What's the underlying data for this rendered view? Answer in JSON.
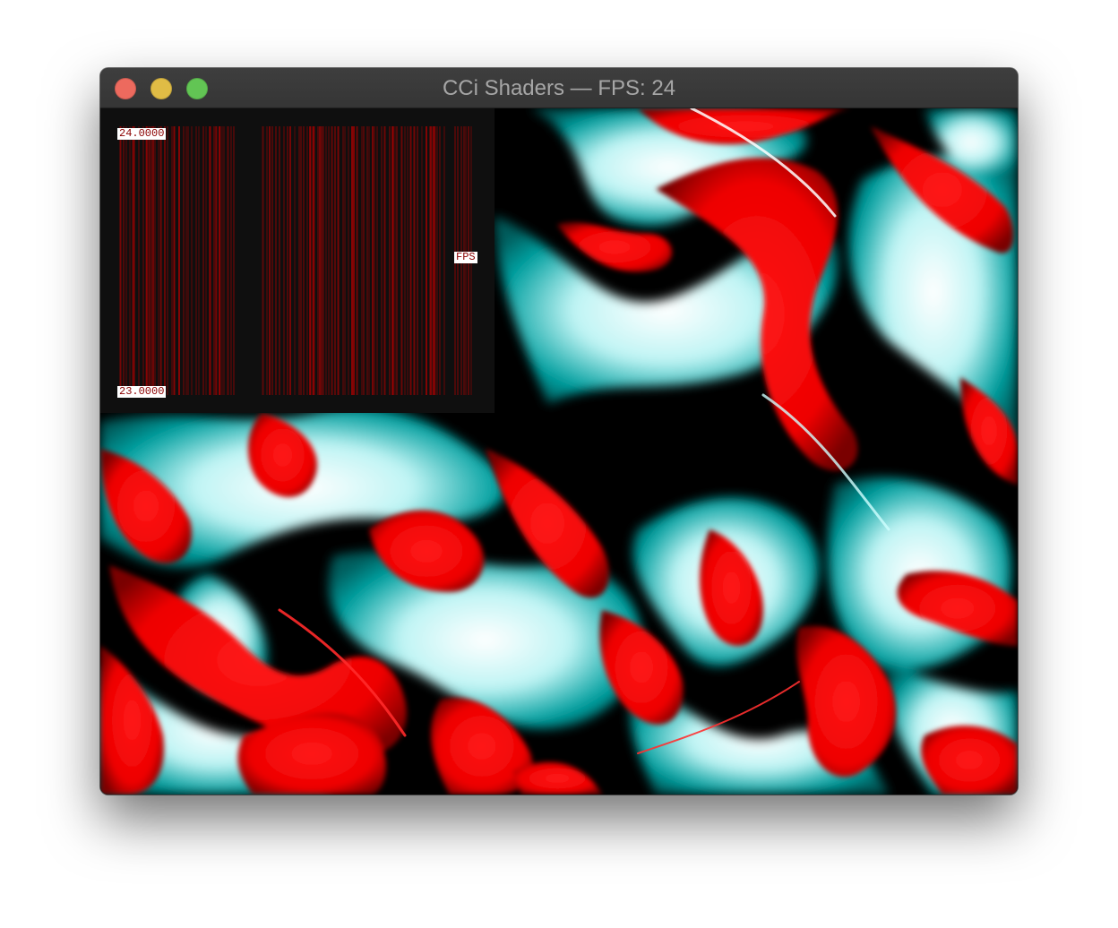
{
  "window": {
    "title": "CCi Shaders — FPS: 24",
    "controls": [
      "close",
      "minimize",
      "zoom"
    ]
  },
  "graph": {
    "max_label": "24.0000",
    "min_label": "23.0000",
    "series_label": "FPS",
    "bar_color": "#b30000"
  },
  "colors": {
    "red": "#ff0000",
    "cyan": "#00aaaa",
    "white": "#ffffff",
    "black": "#000000"
  }
}
